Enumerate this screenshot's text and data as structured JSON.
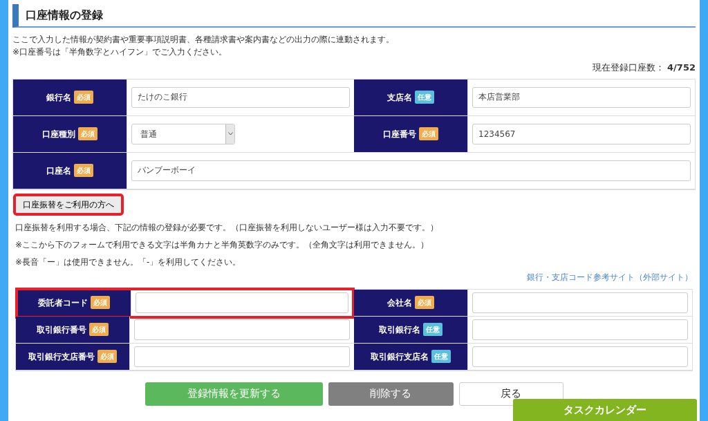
{
  "title": "口座情報の登録",
  "notes": [
    "ここで入力した情報が契約書や重要事項説明書、各種請求書や案内書などの出力の際に連動されます。",
    "※口座番号は「半角数字とハイフン」でご入力ください。"
  ],
  "account_count": {
    "label": "現在登録口座数：",
    "value": "4/752"
  },
  "account_fields": [
    {
      "label": "銀行名",
      "badge": "必須",
      "required": true,
      "kind": "text",
      "value": "たけのこ銀行",
      "wide": false
    },
    {
      "label": "支店名",
      "badge": "任意",
      "required": false,
      "kind": "text",
      "value": "本店営業部",
      "wide": false
    },
    {
      "label": "口座種別",
      "badge": "必須",
      "required": true,
      "kind": "select",
      "value": "普通",
      "wide": false
    },
    {
      "label": "口座番号",
      "badge": "必須",
      "required": true,
      "kind": "text",
      "value": "1234567",
      "wide": false
    },
    {
      "label": "口座名",
      "badge": "必須",
      "required": true,
      "kind": "text",
      "value": "バンブーボーイ",
      "wide": true
    }
  ],
  "transfer_button": {
    "label": "口座振替をご利用の方へ",
    "highlighted": true
  },
  "transfer_notes": [
    "口座振替を利用する場合、下記の情報の登録が必要です。（口座振替を利用しないユーザー様は入力不要です。）",
    "※ここから下のフォームで利用できる文字は半角カナと半角英数字のみです。（全角文字は利用できません。）",
    "※長音「ー」は使用できません。「-」を利用してください。"
  ],
  "reference_link": "銀行・支店コード参考サイト（外部サイト）",
  "transfer_fields": [
    {
      "label": "委託者コード",
      "badge": "必須",
      "required": true,
      "highlighted": true
    },
    {
      "label": "会社名",
      "badge": "必須",
      "required": true,
      "highlighted": false
    },
    {
      "label": "取引銀行番号",
      "badge": "必須",
      "required": true,
      "highlighted": false
    },
    {
      "label": "取引銀行名",
      "badge": "任意",
      "required": false,
      "highlighted": false
    },
    {
      "label": "取引銀行支店番号",
      "badge": "必須",
      "required": true,
      "highlighted": false
    },
    {
      "label": "取引銀行支店名",
      "badge": "任意",
      "required": false,
      "highlighted": false
    }
  ],
  "buttons": [
    {
      "label": "登録情報を更新する",
      "kind": "primary"
    },
    {
      "label": "削除する",
      "kind": "danger"
    },
    {
      "label": "戻る",
      "kind": "back"
    }
  ],
  "task_calendar": "タスクカレンダー"
}
